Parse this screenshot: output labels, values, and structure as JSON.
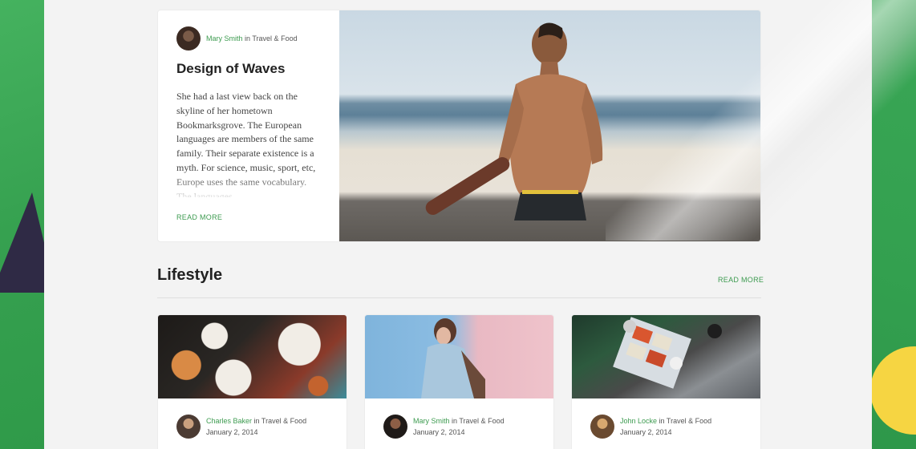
{
  "featured": {
    "author": "Mary Smith",
    "in_text": "in",
    "category": "Travel & Food",
    "title": "Design of Waves",
    "excerpt": "She had a last view back on the skyline of her hometown Bookmarksgrove. The European languages are members of the same family. Their separate existence is a myth. For science, music, sport, etc, Europe uses the same vocabulary. The languages",
    "read_more": "READ MORE"
  },
  "lifestyle": {
    "title": "Lifestyle",
    "read_more": "READ MORE",
    "cards": [
      {
        "author": "Charles Baker",
        "in_text": "in",
        "category": "Travel & Food",
        "date": "January 2, 2014"
      },
      {
        "author": "Mary Smith",
        "in_text": "in",
        "category": "Travel & Food",
        "date": "January 2, 2014"
      },
      {
        "author": "John Locke",
        "in_text": "in",
        "category": "Travel & Food",
        "date": "January 2, 2014"
      }
    ]
  }
}
